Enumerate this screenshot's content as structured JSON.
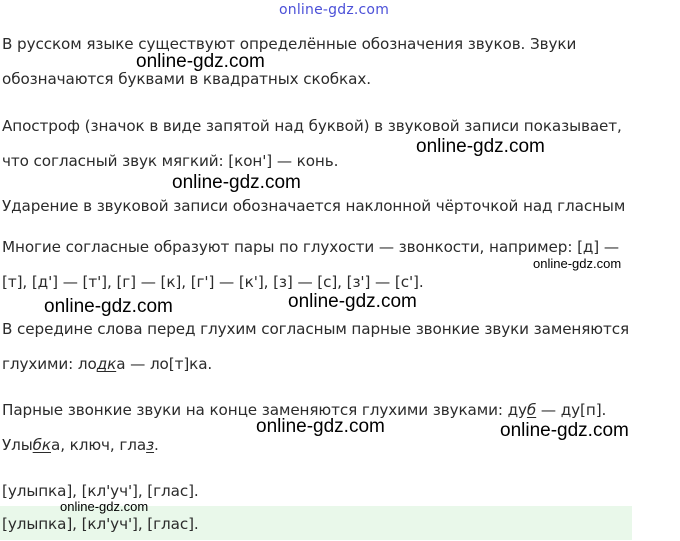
{
  "watermark": {
    "text": "online-gdz.com"
  },
  "lines": [
    "В русском языке существуют определённые обозначения звуков. Звуки",
    "обозначаются буквами в квадратных скобках.",
    "Апостроф (значок в виде запятой над буквой) в звуковой записи показывает,",
    "что согласный звук мягкий: [кон'] — конь.",
    "Ударение в звуковой записи обозначается наклонной чёрточкой над гласным",
    "Многие согласные образуют пары по глухости — звонкости, например: [д] —",
    "[т], [д'] — [т'], [г] — [к], [г'] — [к'], [з] — [с], [з'] — [с'].",
    "В середине слова перед глухим согласным парные звонкие звуки заменяются"
  ],
  "example1": {
    "prefix": "глухими: ло",
    "underlined": "дк",
    "suffix": "а — ло[т]ка."
  },
  "example2": {
    "prefix": "Парные звонкие звуки на конце заменяются глухими звуками: ду",
    "underlined": "б",
    "suffix": " — ду[п]."
  },
  "exercise": {
    "w1a": "Улы",
    "w1u": "бк",
    "w1b": "а, ключ, гла",
    "w2u": "з",
    "w2b": "."
  },
  "answer_draft": "[улыпка], [кл'уч'], [глас].",
  "answer_final": "[улыпка], [кл'уч'], [глас]."
}
